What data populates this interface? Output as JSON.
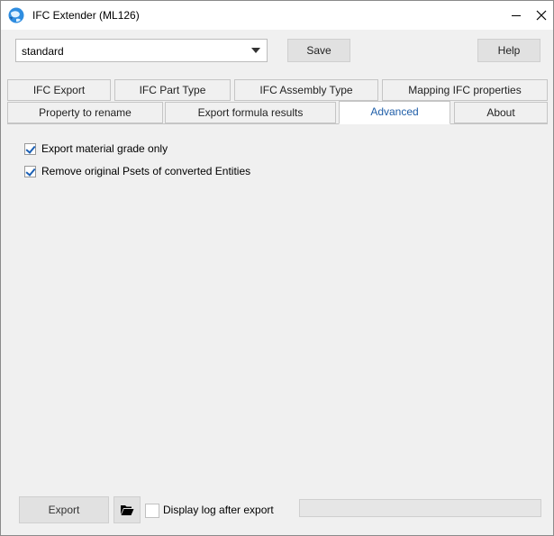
{
  "window": {
    "title": "IFC Extender (ML126)",
    "icon": "globe-app-icon"
  },
  "profile": {
    "selected": "standard"
  },
  "buttons": {
    "save": "Save",
    "help": "Help",
    "export": "Export"
  },
  "tabs_row1": [
    {
      "label": "IFC Export"
    },
    {
      "label": "IFC Part Type"
    },
    {
      "label": "IFC Assembly Type"
    },
    {
      "label": "Mapping IFC properties"
    }
  ],
  "tabs_row2": [
    {
      "label": "Property to rename"
    },
    {
      "label": "Export formula results"
    },
    {
      "label": "Advanced",
      "active": true
    },
    {
      "label": "About"
    }
  ],
  "advanced": {
    "options": [
      {
        "label": "Export material grade only",
        "checked": true
      },
      {
        "label": "Remove original Psets of converted Entities",
        "checked": true
      }
    ]
  },
  "footer": {
    "display_log_label": "Display log after export",
    "display_log_checked": false,
    "progress": 0
  },
  "colors": {
    "active_tab_text": "#1f5ea8",
    "checkmark": "#1a5fb4",
    "window_bg": "#f0f0f0"
  }
}
